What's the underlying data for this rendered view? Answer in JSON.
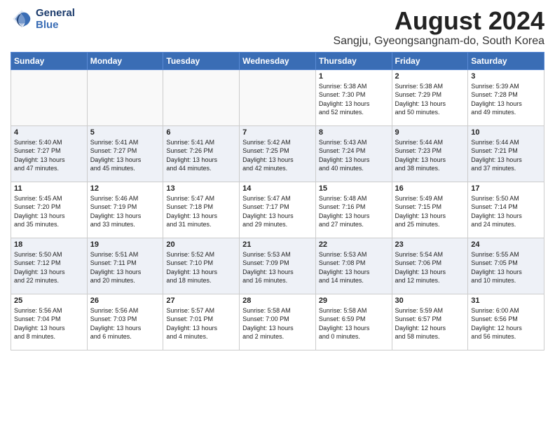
{
  "header": {
    "logo_line1": "General",
    "logo_line2": "Blue",
    "month_year": "August 2024",
    "location": "Sangju, Gyeongsangnam-do, South Korea"
  },
  "weekdays": [
    "Sunday",
    "Monday",
    "Tuesday",
    "Wednesday",
    "Thursday",
    "Friday",
    "Saturday"
  ],
  "weeks": [
    [
      {
        "day": "",
        "info": ""
      },
      {
        "day": "",
        "info": ""
      },
      {
        "day": "",
        "info": ""
      },
      {
        "day": "",
        "info": ""
      },
      {
        "day": "1",
        "info": "Sunrise: 5:38 AM\nSunset: 7:30 PM\nDaylight: 13 hours\nand 52 minutes."
      },
      {
        "day": "2",
        "info": "Sunrise: 5:38 AM\nSunset: 7:29 PM\nDaylight: 13 hours\nand 50 minutes."
      },
      {
        "day": "3",
        "info": "Sunrise: 5:39 AM\nSunset: 7:28 PM\nDaylight: 13 hours\nand 49 minutes."
      }
    ],
    [
      {
        "day": "4",
        "info": "Sunrise: 5:40 AM\nSunset: 7:27 PM\nDaylight: 13 hours\nand 47 minutes."
      },
      {
        "day": "5",
        "info": "Sunrise: 5:41 AM\nSunset: 7:27 PM\nDaylight: 13 hours\nand 45 minutes."
      },
      {
        "day": "6",
        "info": "Sunrise: 5:41 AM\nSunset: 7:26 PM\nDaylight: 13 hours\nand 44 minutes."
      },
      {
        "day": "7",
        "info": "Sunrise: 5:42 AM\nSunset: 7:25 PM\nDaylight: 13 hours\nand 42 minutes."
      },
      {
        "day": "8",
        "info": "Sunrise: 5:43 AM\nSunset: 7:24 PM\nDaylight: 13 hours\nand 40 minutes."
      },
      {
        "day": "9",
        "info": "Sunrise: 5:44 AM\nSunset: 7:23 PM\nDaylight: 13 hours\nand 38 minutes."
      },
      {
        "day": "10",
        "info": "Sunrise: 5:44 AM\nSunset: 7:21 PM\nDaylight: 13 hours\nand 37 minutes."
      }
    ],
    [
      {
        "day": "11",
        "info": "Sunrise: 5:45 AM\nSunset: 7:20 PM\nDaylight: 13 hours\nand 35 minutes."
      },
      {
        "day": "12",
        "info": "Sunrise: 5:46 AM\nSunset: 7:19 PM\nDaylight: 13 hours\nand 33 minutes."
      },
      {
        "day": "13",
        "info": "Sunrise: 5:47 AM\nSunset: 7:18 PM\nDaylight: 13 hours\nand 31 minutes."
      },
      {
        "day": "14",
        "info": "Sunrise: 5:47 AM\nSunset: 7:17 PM\nDaylight: 13 hours\nand 29 minutes."
      },
      {
        "day": "15",
        "info": "Sunrise: 5:48 AM\nSunset: 7:16 PM\nDaylight: 13 hours\nand 27 minutes."
      },
      {
        "day": "16",
        "info": "Sunrise: 5:49 AM\nSunset: 7:15 PM\nDaylight: 13 hours\nand 25 minutes."
      },
      {
        "day": "17",
        "info": "Sunrise: 5:50 AM\nSunset: 7:14 PM\nDaylight: 13 hours\nand 24 minutes."
      }
    ],
    [
      {
        "day": "18",
        "info": "Sunrise: 5:50 AM\nSunset: 7:12 PM\nDaylight: 13 hours\nand 22 minutes."
      },
      {
        "day": "19",
        "info": "Sunrise: 5:51 AM\nSunset: 7:11 PM\nDaylight: 13 hours\nand 20 minutes."
      },
      {
        "day": "20",
        "info": "Sunrise: 5:52 AM\nSunset: 7:10 PM\nDaylight: 13 hours\nand 18 minutes."
      },
      {
        "day": "21",
        "info": "Sunrise: 5:53 AM\nSunset: 7:09 PM\nDaylight: 13 hours\nand 16 minutes."
      },
      {
        "day": "22",
        "info": "Sunrise: 5:53 AM\nSunset: 7:08 PM\nDaylight: 13 hours\nand 14 minutes."
      },
      {
        "day": "23",
        "info": "Sunrise: 5:54 AM\nSunset: 7:06 PM\nDaylight: 13 hours\nand 12 minutes."
      },
      {
        "day": "24",
        "info": "Sunrise: 5:55 AM\nSunset: 7:05 PM\nDaylight: 13 hours\nand 10 minutes."
      }
    ],
    [
      {
        "day": "25",
        "info": "Sunrise: 5:56 AM\nSunset: 7:04 PM\nDaylight: 13 hours\nand 8 minutes."
      },
      {
        "day": "26",
        "info": "Sunrise: 5:56 AM\nSunset: 7:03 PM\nDaylight: 13 hours\nand 6 minutes."
      },
      {
        "day": "27",
        "info": "Sunrise: 5:57 AM\nSunset: 7:01 PM\nDaylight: 13 hours\nand 4 minutes."
      },
      {
        "day": "28",
        "info": "Sunrise: 5:58 AM\nSunset: 7:00 PM\nDaylight: 13 hours\nand 2 minutes."
      },
      {
        "day": "29",
        "info": "Sunrise: 5:58 AM\nSunset: 6:59 PM\nDaylight: 13 hours\nand 0 minutes."
      },
      {
        "day": "30",
        "info": "Sunrise: 5:59 AM\nSunset: 6:57 PM\nDaylight: 12 hours\nand 58 minutes."
      },
      {
        "day": "31",
        "info": "Sunrise: 6:00 AM\nSunset: 6:56 PM\nDaylight: 12 hours\nand 56 minutes."
      }
    ]
  ]
}
